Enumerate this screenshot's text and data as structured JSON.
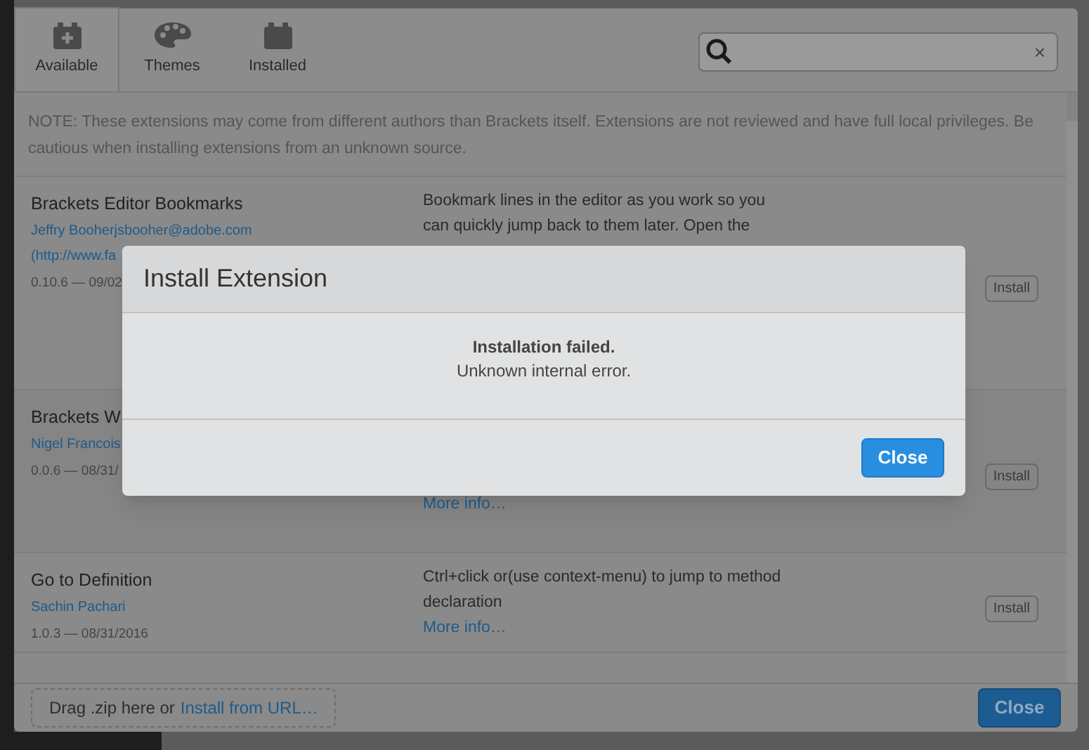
{
  "tabs": [
    {
      "label": "Available",
      "selected": true
    },
    {
      "label": "Themes",
      "selected": false
    },
    {
      "label": "Installed",
      "selected": false
    }
  ],
  "search": {
    "clear": "×"
  },
  "note": "NOTE: These extensions may come from different authors than Brackets itself. Extensions are not reviewed and have full local privileges. Be cautious when installing extensions from an unknown source.",
  "extensions": [
    {
      "name": "Brackets Editor Bookmarks",
      "author_lines": [
        "Jeffry Booherjsbooher@adobe.com",
        "(http://www.fa"
      ],
      "version": "0.10.6 — 09/02",
      "description": "Bookmark lines in the editor as you work so you can quickly jump back to them later. Open the",
      "action": "Install"
    },
    {
      "name": "Brackets W",
      "author_lines": [
        "Nigel Francois"
      ],
      "version": "0.0.6 — 08/31/",
      "more": "More info…",
      "action": "Install"
    },
    {
      "name": "Go to Definition",
      "author_lines": [
        "Sachin Pachari"
      ],
      "version": "1.0.3 — 08/31/2016",
      "description": "Ctrl+click or(use context-menu) to jump to method declaration",
      "more": "More info…",
      "action": "Install"
    }
  ],
  "footer": {
    "drop_text": "Drag .zip here or",
    "link": "Install from URL…",
    "close": "Close"
  },
  "dialog": {
    "title": "Install Extension",
    "heading": "Installation failed.",
    "message": "Unknown internal error.",
    "button": "Close"
  }
}
